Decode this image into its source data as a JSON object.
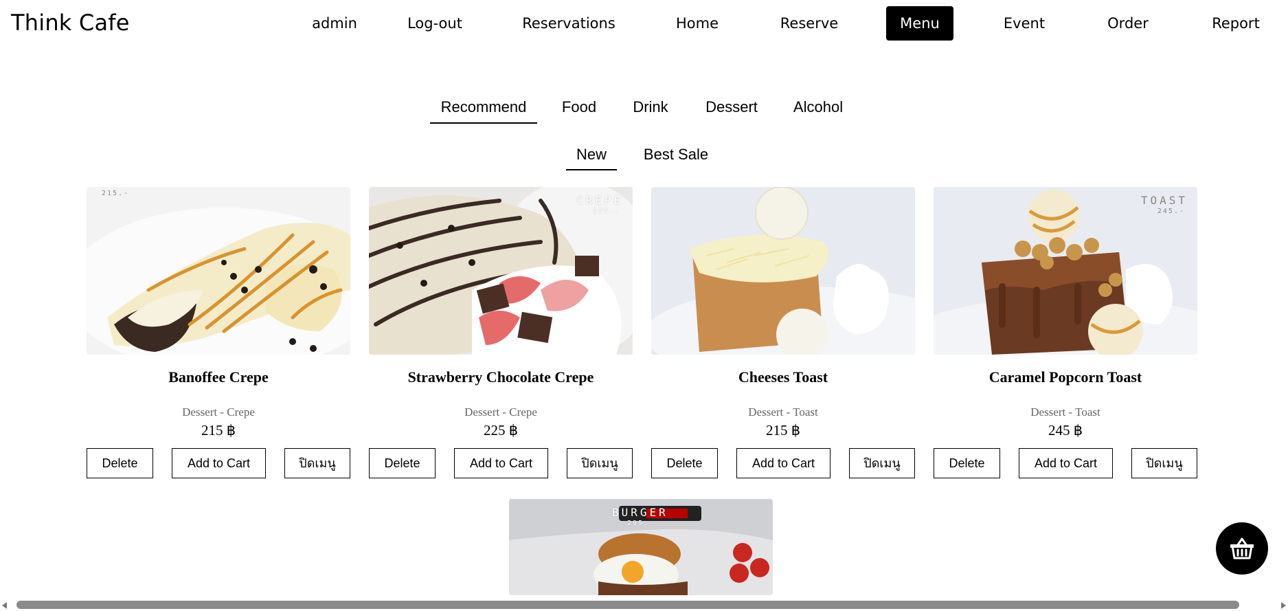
{
  "header": {
    "brand": "Think Cafe",
    "nav": [
      "admin",
      "Log-out",
      "Reservations",
      "Home",
      "Reserve",
      "Menu",
      "Event",
      "Order",
      "Report"
    ],
    "active_nav": "Menu"
  },
  "categories": {
    "tabs": [
      "Recommend",
      "Food",
      "Drink",
      "Dessert",
      "Alcohol"
    ],
    "active": "Recommend"
  },
  "subtabs": {
    "items": [
      "New",
      "Best Sale"
    ],
    "active": "New"
  },
  "buttons": {
    "delete": "Delete",
    "add_to_cart": "Add to Cart",
    "close_menu": "ปิดเมนู"
  },
  "products": [
    {
      "name": "Banoffee Crepe",
      "category": "Dessert - Crepe",
      "price": "215 ฿",
      "image_tag": "",
      "image_price_tag": "215.-"
    },
    {
      "name": "Strawberry Chocolate Crepe",
      "category": "Dessert - Crepe",
      "price": "225 ฿",
      "image_tag": "CREPE",
      "image_price_tag": "225.-"
    },
    {
      "name": "Cheeses Toast",
      "category": "Dessert - Toast",
      "price": "215 ฿",
      "image_tag": "",
      "image_price_tag": ""
    },
    {
      "name": "Caramel Popcorn Toast",
      "category": "Dessert - Toast",
      "price": "245 ฿",
      "image_tag": "TOAST",
      "image_price_tag": "245.-"
    }
  ],
  "partial_product": {
    "image_tag": "BURGER",
    "image_price_tag": "295.-"
  },
  "colors": {
    "active_nav_bg": "#000000",
    "cart_fab_bg": "#000000",
    "category_text": "#666666"
  },
  "icons": {
    "cart": "basket-icon"
  }
}
